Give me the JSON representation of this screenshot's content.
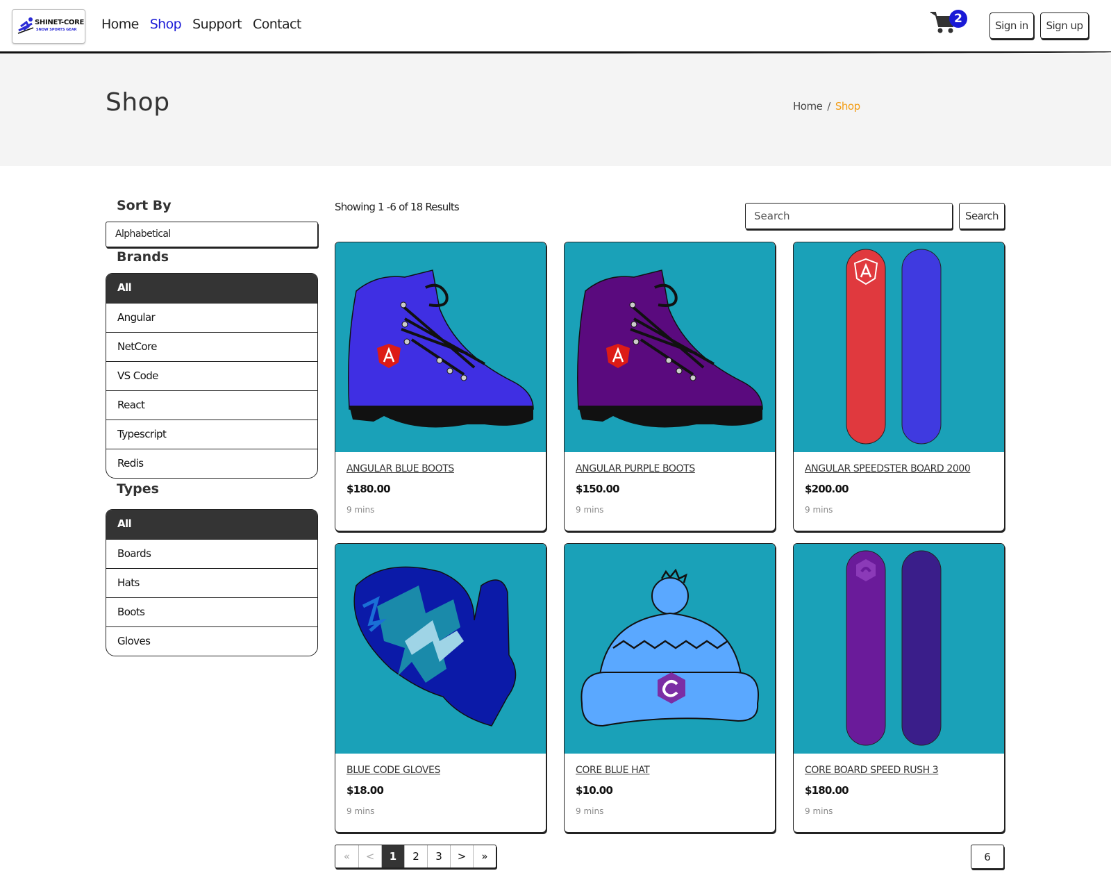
{
  "brand": {
    "name": "SHINET-CORE",
    "tagline": "SNOW SPORTS GEAR"
  },
  "nav": {
    "links": [
      "Home",
      "Shop",
      "Support",
      "Contact"
    ],
    "active": "Shop",
    "cart_count": "2",
    "sign_in": "Sign in",
    "sign_up": "Sign up"
  },
  "hero": {
    "title": "Shop",
    "breadcrumb": [
      "Home",
      "Shop"
    ],
    "separator": "/"
  },
  "sidebar": {
    "sort_heading": "Sort By",
    "sort_value": "Alphabetical",
    "brands_heading": "Brands",
    "brands": [
      "All",
      "Angular",
      "NetCore",
      "VS Code",
      "React",
      "Typescript",
      "Redis"
    ],
    "brands_active": "All",
    "types_heading": "Types",
    "types": [
      "All",
      "Boards",
      "Hats",
      "Boots",
      "Gloves"
    ],
    "types_active": "All"
  },
  "main": {
    "results_text": "Showing 1 -6 of 18 Results",
    "search_placeholder": "Search",
    "search_button": "Search"
  },
  "products": [
    {
      "name": "ANGULAR BLUE BOOTS",
      "price": "$180.00",
      "meta": "9 mins",
      "image": "blue-boot-icon"
    },
    {
      "name": "ANGULAR PURPLE BOOTS",
      "price": "$150.00",
      "meta": "9 mins",
      "image": "purple-boot-icon"
    },
    {
      "name": "ANGULAR SPEEDSTER BOARD 2000",
      "price": "$200.00",
      "meta": "9 mins",
      "image": "red-blue-boards-icon"
    },
    {
      "name": "BLUE CODE GLOVES",
      "price": "$18.00",
      "meta": "9 mins",
      "image": "blue-glove-icon"
    },
    {
      "name": "CORE BLUE HAT",
      "price": "$10.00",
      "meta": "9 mins",
      "image": "blue-beanie-icon"
    },
    {
      "name": "CORE BOARD SPEED RUSH 3",
      "price": "$180.00",
      "meta": "9 mins",
      "image": "purple-boards-icon"
    }
  ],
  "pagination": {
    "first": "«",
    "prev": "<",
    "pages": [
      "1",
      "2",
      "3"
    ],
    "active": "1",
    "next": ">",
    "last": "»",
    "page_size": "6"
  },
  "colors": {
    "accent": "#1a1ad6",
    "breadcrumb_current": "#f39c12",
    "card_image_bg": "#1aa1b8",
    "active_item_bg": "#343434",
    "hero_bg": "#f4f4f4"
  }
}
